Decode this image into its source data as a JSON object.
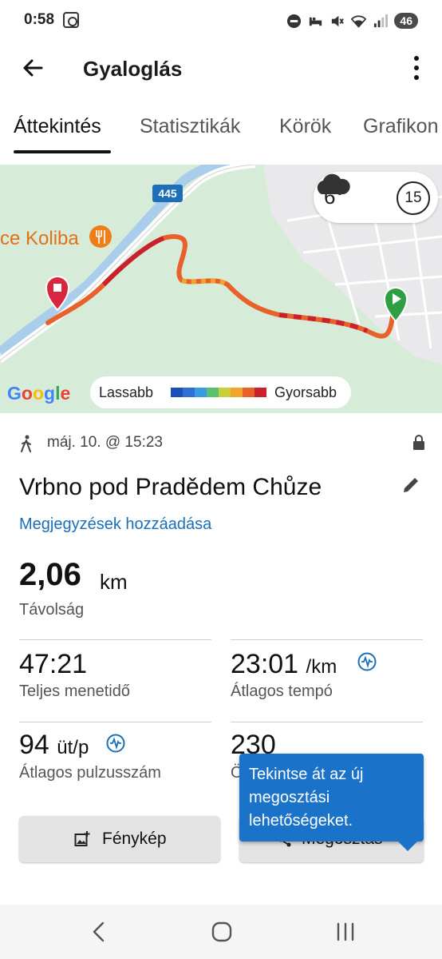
{
  "status_bar": {
    "time": "0:58",
    "battery": "46",
    "icons": [
      "screenshot-icon",
      "do-not-disturb-icon",
      "sleep-mode-icon",
      "mute-icon",
      "wifi-icon",
      "signal-icon"
    ]
  },
  "app_bar": {
    "title": "Gyaloglás",
    "back_icon": "arrow-left-icon",
    "menu_icon": "more-vertical-icon"
  },
  "tabs": [
    {
      "label": "Áttekintés",
      "active": true
    },
    {
      "label": "Statisztikák",
      "active": false
    },
    {
      "label": "Körök",
      "active": false
    },
    {
      "label": "Grafikon",
      "active": false
    }
  ],
  "map": {
    "road_label": "445",
    "poi_label": "ce Koliba",
    "google_logo": "Google",
    "weather": {
      "temp": "6°",
      "icon": "cloud-icon",
      "wind": "15"
    },
    "legend": {
      "slow_label": "Lassabb",
      "fast_label": "Gyorsabb",
      "colors": [
        "#1c4fb5",
        "#2e6fd4",
        "#3b9be0",
        "#59c070",
        "#c8cf3a",
        "#f2a32b",
        "#e8612b",
        "#c9222d"
      ]
    },
    "colors": {
      "background": "#d7ecd8",
      "start_marker": "#2ea043",
      "end_marker": "#d7263d",
      "poi": "#ef7d1a"
    }
  },
  "activity": {
    "type_icon": "walking-icon",
    "date": "máj. 10. @ 15:23",
    "privacy_icon": "lock-icon",
    "name": "Vrbno pod Pradědem Chůze",
    "edit_icon": "pencil-icon",
    "add_notes": "Megjegyzések hozzáadása"
  },
  "distance": {
    "value": "2,06",
    "unit": "km",
    "label": "Távolság"
  },
  "stats": {
    "total_time": {
      "value": "47:21",
      "label": "Teljes menetidő"
    },
    "avg_pace": {
      "value": "23:01",
      "unit": "/km",
      "label": "Átlagos tempó"
    },
    "avg_hr": {
      "value": "94",
      "unit": "üt/p",
      "label": "Átlagos pulzusszám"
    },
    "fourth": {
      "value": "230",
      "label": "Ö"
    }
  },
  "buttons": {
    "photo": "Fénykép",
    "share": "Megosztás"
  },
  "tooltip": {
    "text": "Tekintse át az új megosztási lehetőségeket."
  },
  "nav_bar": {
    "icons": [
      "back-nav-icon",
      "home-nav-icon",
      "recents-nav-icon"
    ]
  }
}
